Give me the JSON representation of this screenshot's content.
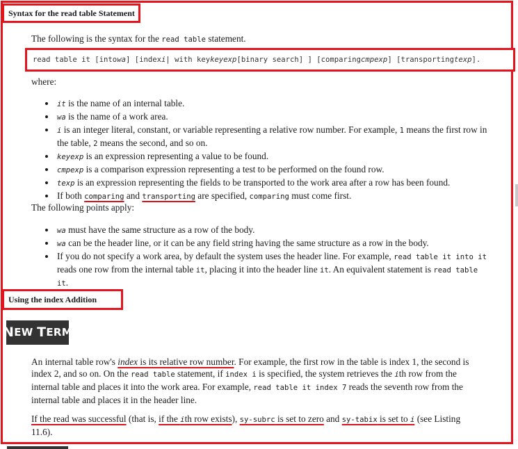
{
  "section1": {
    "heading": "Syntax for the read table Statement",
    "intro_before": "The following is the syntax for the ",
    "intro_code": "read table",
    "intro_after": " statement.",
    "syntax": {
      "p1": "read table it [into ",
      "wa": "wa",
      "p2": "] [index ",
      "i": "i",
      "p3": " | with key ",
      "keyexp": "keyexp",
      "p4": " [binary search] ] [comparing ",
      "cmpexp": "cmpexp",
      "p5": "] [transporting ",
      "texp": "texp",
      "p6": "]."
    },
    "where_label": "where:",
    "where_items": [
      {
        "code": "it",
        "text": " is the name of an internal table."
      },
      {
        "code": "wa",
        "text": " is the name of a work area."
      },
      {
        "code": "i",
        "text_a": " is an integer literal, constant, or variable representing a relative row number. For example, ",
        "code_1": "1",
        "text_b": " means the first row in the table, ",
        "code_2": "2",
        "text_c": " means the second, and so on."
      },
      {
        "code": "keyexp",
        "text": " is an expression representing a value to be found."
      },
      {
        "code": "cmpexp",
        "text": " is a comparison expression representing a test to be performed on the found row."
      },
      {
        "code": "texp",
        "text": " is an expression representing the fields to be transported to the work area after a row has been found."
      },
      {
        "text_a": "If both ",
        "code_1": "comparing",
        "text_b": " and ",
        "code_2": "transporting",
        "text_c": " are specified, ",
        "code_3": "comparing",
        "text_d": " must come first."
      }
    ],
    "points_label": "The following points apply:",
    "points": [
      {
        "code": "wa",
        "text": " must have the same structure as a row of the body."
      },
      {
        "code": "wa",
        "text": " can be the header line, or it can be any field string having the same structure as a row in the body."
      },
      {
        "text_a": "If you do not specify a work area, by default the system uses the header line. For example, ",
        "code_1": "read table it into it",
        "text_b": " reads one row from the internal table ",
        "code_2": "it",
        "text_c": ", placing it into the header line ",
        "code_3": "it",
        "text_d": ". An equivalent statement is ",
        "code_4": "read table it",
        "text_e": "."
      }
    ]
  },
  "section2": {
    "heading": "Using the index Addition",
    "badge": {
      "first_big": "N",
      "first_rest": "EW ",
      "second_big": "T",
      "second_rest": "ERM"
    },
    "para1": {
      "a": "An internal table row's ",
      "index_word": "index",
      "b": " is its relative row number",
      "c": ". For example, the first row in the table is index 1, the second is index 2, and so on. On the ",
      "code_1": "read table",
      "d": " statement, if ",
      "code_2": "index i",
      "e": " is specified, the system retrieves the ",
      "code_3": "i",
      "f": "th row from the internal table and places it into the work area. For example, ",
      "code_4": "read table it index 7",
      "g": " reads the seventh row from the internal table and places it in the header line."
    },
    "para2": {
      "a": "If the read was successful",
      "b": " (that is, ",
      "c1": "if the ",
      "code_i": "i",
      "c2": "th row exists",
      "d": "), ",
      "code_subrc": "sy-subrc",
      "e": " is set to zero",
      "f": " and ",
      "code_tabix": "sy-tabix",
      "g": " is set to ",
      "code_i2": "i",
      "h": " (see Listing 11.6)."
    }
  },
  "colors": {
    "annotation_red": "#e3141b",
    "badge_bg": "#333333"
  }
}
